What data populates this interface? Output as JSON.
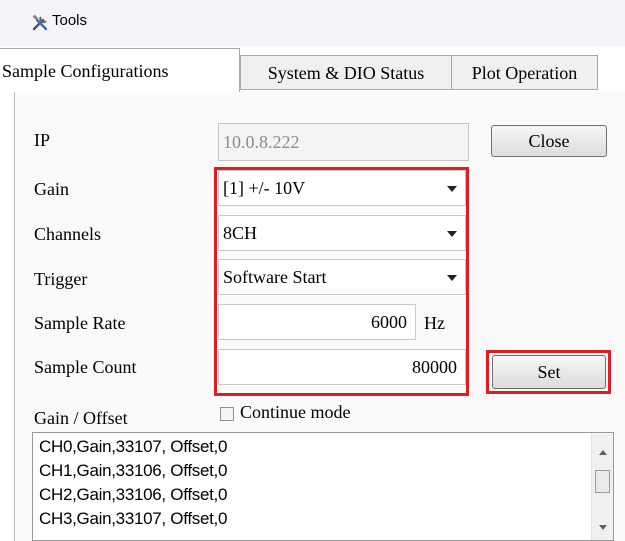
{
  "toolbar": {
    "title": "Tools",
    "icon": "tools-icon"
  },
  "tabs": [
    {
      "label": "Sample Configurations",
      "active": true
    },
    {
      "label": "System & DIO Status",
      "active": false
    },
    {
      "label": "Plot Operation",
      "active": false
    }
  ],
  "form": {
    "ip": {
      "label": "IP",
      "value": "10.0.8.222"
    },
    "gain": {
      "label": "Gain",
      "value": "[1] +/- 10V"
    },
    "channels": {
      "label": "Channels",
      "value": "8CH"
    },
    "trigger": {
      "label": "Trigger",
      "value": "Software Start"
    },
    "sample_rate": {
      "label": "Sample Rate",
      "value": "6000",
      "unit": "Hz"
    },
    "sample_count": {
      "label": "Sample Count",
      "value": "80000"
    },
    "gain_offset_label": "Gain / Offset",
    "continue_mode": {
      "label": "Continue mode",
      "checked": false
    }
  },
  "buttons": {
    "close": "Close",
    "set": "Set"
  },
  "gain_offset_lines": [
    "CH0,Gain,33107, Offset,0",
    "CH1,Gain,33106, Offset,0",
    "CH2,Gain,33106, Offset,0",
    "CH3,Gain,33107, Offset,0"
  ],
  "colors": {
    "highlight": "#e01b24"
  }
}
